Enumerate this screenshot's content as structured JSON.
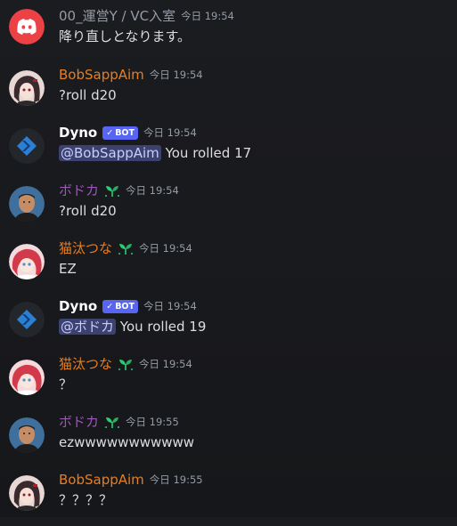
{
  "colors": {
    "background": "#1b1c20",
    "orange_name": "#e67e22",
    "purple_name": "#9b59b6",
    "dyno_name": "#ffffff",
    "system_name": "#949ba4",
    "bot_badge": "#5865f2",
    "mention_bg": "#3c4270",
    "discord_red": "#ed4245"
  },
  "messages": [
    {
      "author": "00_運営Y / VC入室",
      "timestamp": "今日 19:54",
      "text": "降り直しとなります。",
      "avatar": "discord-logo-icon"
    },
    {
      "author": "BobSappAim",
      "timestamp": "今日 19:54",
      "text": "?roll d20",
      "avatar": "anime-girl-avatar"
    },
    {
      "author": "Dyno",
      "badge": "BOT",
      "timestamp": "今日 19:54",
      "mention": "@BobSappAim",
      "text": "You rolled 17",
      "avatar": "dyno-logo-icon"
    },
    {
      "author": "ボドカ",
      "timestamp": "今日 19:54",
      "text": "?roll d20",
      "avatar": "man-photo-avatar"
    },
    {
      "author": "猫汰つな",
      "timestamp": "今日 19:54",
      "text": "EZ",
      "avatar": "anime-redhair-avatar"
    },
    {
      "author": "Dyno",
      "badge": "BOT",
      "timestamp": "今日 19:54",
      "mention": "@ボドカ",
      "text": "You rolled 19",
      "avatar": "dyno-logo-icon"
    },
    {
      "author": "猫汰つな",
      "timestamp": "今日 19:54",
      "text": "？",
      "avatar": "anime-redhair-avatar"
    },
    {
      "author": "ボドカ",
      "timestamp": "今日 19:55",
      "text": "ezwwwwwwwwwww",
      "avatar": "man-photo-avatar"
    },
    {
      "author": "BobSappAim",
      "timestamp": "今日 19:55",
      "text": "？？？？",
      "avatar": "anime-girl-avatar"
    }
  ]
}
